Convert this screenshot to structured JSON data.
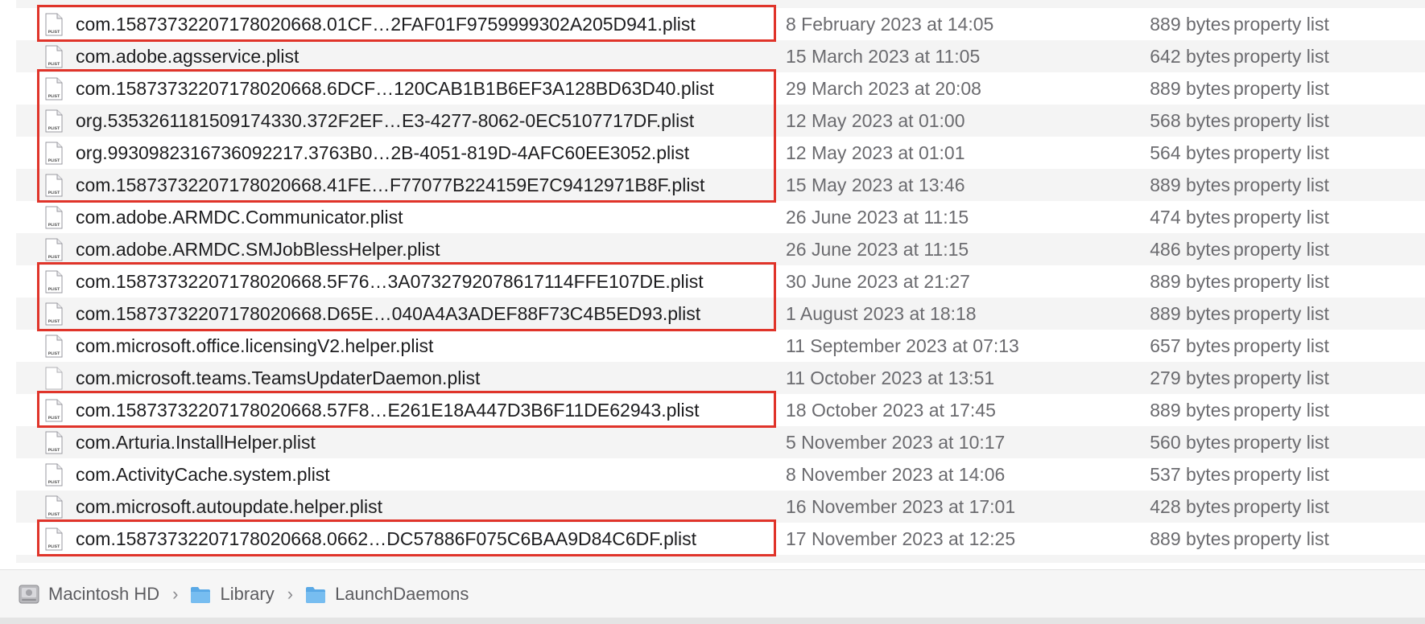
{
  "files": [
    {
      "name": "com.15873732207178020668.01CF…2FAF01F9759999302A205D941.plist",
      "date": "8 February 2023 at 14:05",
      "size": "889 bytes",
      "kind": "property list",
      "icon": "plist-file-icon",
      "highlighted": true
    },
    {
      "name": "com.adobe.agsservice.plist",
      "date": "15 March 2023 at 11:05",
      "size": "642 bytes",
      "kind": "property list",
      "icon": "plist-file-icon",
      "highlighted": false
    },
    {
      "name": "com.15873732207178020668.6DCF…120CAB1B1B6EF3A128BD63D40.plist",
      "date": "29 March 2023 at 20:08",
      "size": "889 bytes",
      "kind": "property list",
      "icon": "plist-file-icon",
      "highlighted": true
    },
    {
      "name": "org.5353261181509174330.372F2EF…E3-4277-8062-0EC5107717DF.plist",
      "date": "12 May 2023 at 01:00",
      "size": "568 bytes",
      "kind": "property list",
      "icon": "plist-file-icon",
      "highlighted": true
    },
    {
      "name": "org.9930982316736092217.3763B0…2B-4051-819D-4AFC60EE3052.plist",
      "date": "12 May 2023 at 01:01",
      "size": "564 bytes",
      "kind": "property list",
      "icon": "plist-file-icon",
      "highlighted": true
    },
    {
      "name": "com.15873732207178020668.41FE…F77077B224159E7C9412971B8F.plist",
      "date": "15 May 2023 at 13:46",
      "size": "889 bytes",
      "kind": "property list",
      "icon": "plist-file-icon",
      "highlighted": true
    },
    {
      "name": "com.adobe.ARMDC.Communicator.plist",
      "date": "26 June 2023 at 11:15",
      "size": "474 bytes",
      "kind": "property list",
      "icon": "plist-file-icon",
      "highlighted": false
    },
    {
      "name": "com.adobe.ARMDC.SMJobBlessHelper.plist",
      "date": "26 June 2023 at 11:15",
      "size": "486 bytes",
      "kind": "property list",
      "icon": "plist-file-icon",
      "highlighted": false
    },
    {
      "name": "com.15873732207178020668.5F76…3A0732792078617114FFE107DE.plist",
      "date": "30 June 2023 at 21:27",
      "size": "889 bytes",
      "kind": "property list",
      "icon": "plist-file-icon",
      "highlighted": true
    },
    {
      "name": "com.15873732207178020668.D65E…040A4A3ADEF88F73C4B5ED93.plist",
      "date": "1 August 2023 at 18:18",
      "size": "889 bytes",
      "kind": "property list",
      "icon": "plist-file-icon",
      "highlighted": true
    },
    {
      "name": "com.microsoft.office.licensingV2.helper.plist",
      "date": "11 September 2023 at 07:13",
      "size": "657 bytes",
      "kind": "property list",
      "icon": "plist-file-icon",
      "highlighted": false
    },
    {
      "name": "com.microsoft.teams.TeamsUpdaterDaemon.plist",
      "date": "11 October 2023 at 13:51",
      "size": "279 bytes",
      "kind": "property list",
      "icon": "blank-file-icon",
      "highlighted": false
    },
    {
      "name": "com.15873732207178020668.57F8…E261E18A447D3B6F11DE62943.plist",
      "date": "18 October 2023 at 17:45",
      "size": "889 bytes",
      "kind": "property list",
      "icon": "plist-file-icon",
      "highlighted": true
    },
    {
      "name": "com.Arturia.InstallHelper.plist",
      "date": "5 November 2023 at 10:17",
      "size": "560 bytes",
      "kind": "property list",
      "icon": "plist-file-icon",
      "highlighted": false
    },
    {
      "name": "com.ActivityCache.system.plist",
      "date": "8 November 2023 at 14:06",
      "size": "537 bytes",
      "kind": "property list",
      "icon": "plist-file-icon",
      "highlighted": false
    },
    {
      "name": "com.microsoft.autoupdate.helper.plist",
      "date": "16 November 2023 at 17:01",
      "size": "428 bytes",
      "kind": "property list",
      "icon": "plist-file-icon",
      "highlighted": false
    },
    {
      "name": "com.15873732207178020668.0662…DC57886F075C6BAA9D84C6DF.plist",
      "date": "17 November 2023 at 12:25",
      "size": "889 bytes",
      "kind": "property list",
      "icon": "plist-file-icon",
      "highlighted": true
    }
  ],
  "path_bar": [
    {
      "label": "Macintosh HD",
      "icon": "hard-drive-icon"
    },
    {
      "label": "Library",
      "icon": "folder-icon"
    },
    {
      "label": "LaunchDaemons",
      "icon": "folder-icon"
    }
  ],
  "colors": {
    "highlight": "#e0342a",
    "row_alt": "#f4f4f4",
    "folder_blue": "#5aa9e6",
    "text_primary": "#1d1d1f",
    "text_secondary": "#6b6b6f"
  }
}
